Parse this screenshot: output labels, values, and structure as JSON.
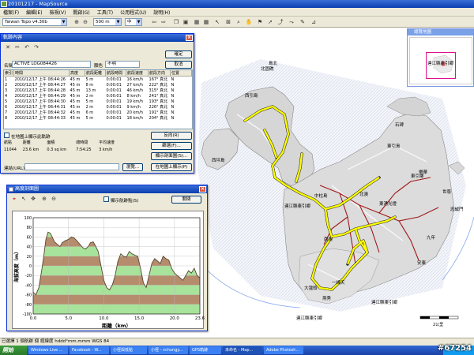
{
  "window": {
    "title": "20101217 - MapSource"
  },
  "menu": [
    "檔案(F)",
    "編輯(E)",
    "檢視(V)",
    "開啟(G)",
    "工具(T)",
    "公用程式(U)",
    "說明(H)"
  ],
  "toolbar": {
    "map_product": "Taiwan Topo v4.30b",
    "zoom": "500 m",
    "detail": "中"
  },
  "overview": {
    "title": "總覽地圖",
    "label": "連江縣東引鄉"
  },
  "map_labels": [
    "島北",
    "北固礁",
    "西引島",
    "東引島",
    "中柱島",
    "北澳",
    "東湧光燈",
    "連江縣東引鄉",
    "南澳",
    "大彊頭",
    "燕秀",
    "一線天",
    "天后宮",
    "九年",
    "安東",
    "樂華",
    "北海坑道",
    "三山",
    "西坪島",
    "海濱",
    "東引鄉",
    "國光",
    "石碑",
    "中柱鐵堤",
    "世尊",
    "忠誠門",
    "大澳",
    "南澳",
    "長島",
    "烈女義坑"
  ],
  "map_scale": "2公里",
  "map_scale_label": "東引鄉東引鄉",
  "track_dialog": {
    "title": "軌跡內容",
    "name_label": "名稱",
    "name_value": "ACTIVE LOG084426",
    "color_label": "顏色",
    "color_value": "不明",
    "ok_label": "確定",
    "cancel_label": "取消",
    "columns": [
      "索引",
      "時間",
      "高度",
      "航段距離",
      "航段時間",
      "航段速度",
      "航段方向",
      "位置"
    ],
    "rows": [
      [
        "1",
        "2010/12/17 上午 08:44:26",
        "45 m",
        "5 m",
        "0:00:01",
        "16 km/h",
        "167° 真北",
        "N"
      ],
      [
        "2",
        "2010/12/17 上午 08:44:27",
        "45 m",
        "8 m",
        "0:00:01",
        "27 km/h",
        "222° 真北",
        "N"
      ],
      [
        "3",
        "2010/12/17 上午 08:44:28",
        "45 m",
        "13 m",
        "0:00:01",
        "46 km/h",
        "315° 真北",
        "N"
      ],
      [
        "4",
        "2010/12/17 上午 08:44:29",
        "45 m",
        "2 m",
        "0:00:01",
        "8 km/h",
        "241° 真北",
        "N"
      ],
      [
        "5",
        "2010/12/17 上午 08:44:30",
        "45 m",
        "5 m",
        "0:00:01",
        "19 km/h",
        "193° 真北",
        "N"
      ],
      [
        "6",
        "2010/12/17 上午 08:44:31",
        "45 m",
        "2 m",
        "0:00:01",
        "9 km/h",
        "226° 真北",
        "N"
      ],
      [
        "7",
        "2010/12/17 上午 08:44:32",
        "45 m",
        "6 m",
        "0:00:01",
        "20 km/h",
        "191° 真北",
        "N"
      ],
      [
        "8",
        "2010/12/17 上午 08:44:33",
        "45 m",
        "5 m",
        "0:00:01",
        "18 km/h",
        "204° 真北",
        "N"
      ]
    ],
    "checkbox_label": "在地圖上顯示此軌跡",
    "show_on_map_btn": "在地圖上顯示(P)",
    "summary_columns": [
      "航點",
      "距離",
      "面積",
      "總時間",
      "平均速度"
    ],
    "summary_values": [
      "11044",
      "23.6 km",
      "0.3 sq km",
      "7:54:25",
      "3 km/h"
    ],
    "reverse_btn": "反向(R)",
    "filter_btn": "篩選(F)...",
    "profile_btn": "顯示剖面圖(S)...",
    "url_label": "連結(URL):",
    "browse_btn": "瀏覽..."
  },
  "elevation": {
    "title": "高度剖面圖",
    "show_points_label": "顯示航跡點(S)",
    "close_label": "關閉",
    "ylabel": "海拔高度（m）",
    "xlabel": "距離（km）"
  },
  "chart_data": {
    "type": "area",
    "title": "",
    "xlabel": "距離（km）",
    "ylabel": "海拔高度（m）",
    "xlim": [
      0,
      23.6
    ],
    "ylim": [
      -100,
      100
    ],
    "x_ticks": [
      "0.0",
      "5.0",
      "10.0",
      "15.0",
      "20.0",
      "23.6"
    ],
    "y_ticks": [
      "100",
      "80",
      "60",
      "40",
      "20",
      "0",
      "-20",
      "-40",
      "-60",
      "-80",
      "-100"
    ],
    "x": [
      0,
      0.4,
      0.8,
      1.2,
      1.5,
      1.8,
      2.1,
      2.4,
      2.7,
      3.0,
      3.4,
      3.8,
      4.1,
      4.5,
      5.0,
      5.4,
      5.8,
      6.2,
      6.6,
      7.0,
      7.4,
      7.8,
      8.1,
      8.5,
      8.8,
      9.2,
      9.6,
      10.0,
      10.4,
      10.8,
      11.2,
      11.6,
      12.0,
      12.4,
      12.8,
      13.2,
      13.6,
      14.0,
      14.4,
      14.8,
      15.2,
      15.6,
      16.0,
      16.4,
      16.8,
      17.2,
      17.6,
      18.0,
      18.4,
      18.8,
      19.2,
      19.6,
      20.0,
      20.4,
      20.8,
      21.2,
      21.6,
      22.0,
      22.4,
      22.8,
      23.2,
      23.6
    ],
    "y": [
      -55,
      -60,
      -45,
      -10,
      20,
      55,
      70,
      68,
      60,
      50,
      45,
      40,
      48,
      52,
      55,
      60,
      58,
      52,
      45,
      38,
      35,
      40,
      48,
      50,
      42,
      30,
      0,
      -30,
      -45,
      -50,
      -40,
      -20,
      10,
      25,
      20,
      18,
      30,
      25,
      22,
      20,
      -5,
      -35,
      -45,
      -20,
      5,
      15,
      10,
      5,
      20,
      15,
      12,
      -5,
      -15,
      -20,
      -25,
      -30,
      -20,
      -10,
      -15,
      -5,
      -20,
      -25
    ],
    "series_colors": {
      "fill_light": "#a7e39a",
      "fill_dark": "#b58c6c",
      "line": "#5a4632"
    }
  },
  "status": {
    "text": "已選擇 1 個航跡 個  經緯度 hddd°mm.mmm WGS 84"
  },
  "taskbar": {
    "start": "開始",
    "tasks": [
      "Windows Live ...",
      "Facebook - W...",
      "小徑與低點",
      "小徑 - vchungy...",
      "GPS軌跡",
      "未命名 - Map...",
      "Adobe Photosh..."
    ],
    "clock": "上午 11:02"
  },
  "watermark": "#67254"
}
